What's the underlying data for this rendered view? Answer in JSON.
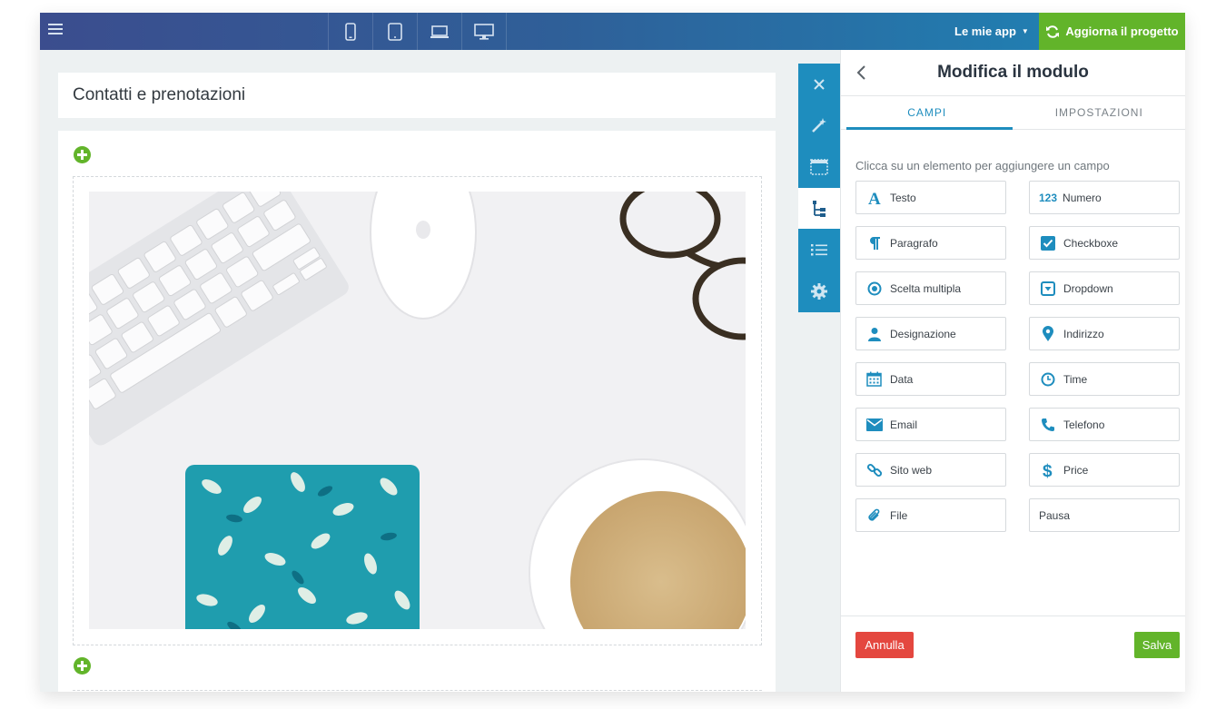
{
  "colors": {
    "accent": "#1e8dbe",
    "primary_green": "#62b42a",
    "danger_red": "#e4473f",
    "topbar_start": "#3b4d8e",
    "topbar_end": "#1d87b8"
  },
  "topbar": {
    "menu_icon": "hamburger-icon",
    "devices": [
      {
        "name": "smartphone",
        "icon": "smartphone-icon"
      },
      {
        "name": "tablet",
        "icon": "tablet-icon"
      },
      {
        "name": "laptop",
        "icon": "laptop-icon"
      },
      {
        "name": "desktop",
        "icon": "desktop-icon"
      }
    ],
    "my_apps_label": "Le mie app",
    "update_label": "Aggiorna il progetto"
  },
  "canvas": {
    "page_title": "Contatti e prenotazioni",
    "image": "desk-photo"
  },
  "iconbar": [
    {
      "icon": "close-icon",
      "active": false
    },
    {
      "icon": "magic-wand-icon",
      "active": false
    },
    {
      "icon": "layout-icon",
      "active": false
    },
    {
      "icon": "tree-structure-icon",
      "active": true
    },
    {
      "icon": "list-icon",
      "active": false
    },
    {
      "icon": "gear-icon",
      "active": false
    }
  ],
  "panel": {
    "title": "Modifica il modulo",
    "tabs": [
      {
        "label": "CAMPI",
        "active": true
      },
      {
        "label": "IMPOSTAZIONI",
        "active": false
      }
    ],
    "hint": "Clicca su un elemento per aggiungere un campo",
    "fields": [
      {
        "label": "Testo",
        "icon": "text-icon"
      },
      {
        "label": "Numero",
        "icon": "number-icon",
        "icon_text": "123"
      },
      {
        "label": "Paragrafo",
        "icon": "paragraph-icon"
      },
      {
        "label": "Checkboxe",
        "icon": "checkbox-icon"
      },
      {
        "label": "Scelta multipla",
        "icon": "radio-icon"
      },
      {
        "label": "Dropdown",
        "icon": "dropdown-icon"
      },
      {
        "label": "Designazione",
        "icon": "user-icon"
      },
      {
        "label": "Indirizzo",
        "icon": "map-pin-icon"
      },
      {
        "label": "Data",
        "icon": "calendar-icon"
      },
      {
        "label": "Time",
        "icon": "clock-icon"
      },
      {
        "label": "Email",
        "icon": "envelope-icon"
      },
      {
        "label": "Telefono",
        "icon": "phone-icon"
      },
      {
        "label": "Sito web",
        "icon": "link-icon"
      },
      {
        "label": "Price",
        "icon": "dollar-icon"
      },
      {
        "label": "File",
        "icon": "paperclip-icon"
      },
      {
        "label": "Pausa",
        "icon": ""
      }
    ],
    "cancel_label": "Annulla",
    "save_label": "Salva"
  }
}
